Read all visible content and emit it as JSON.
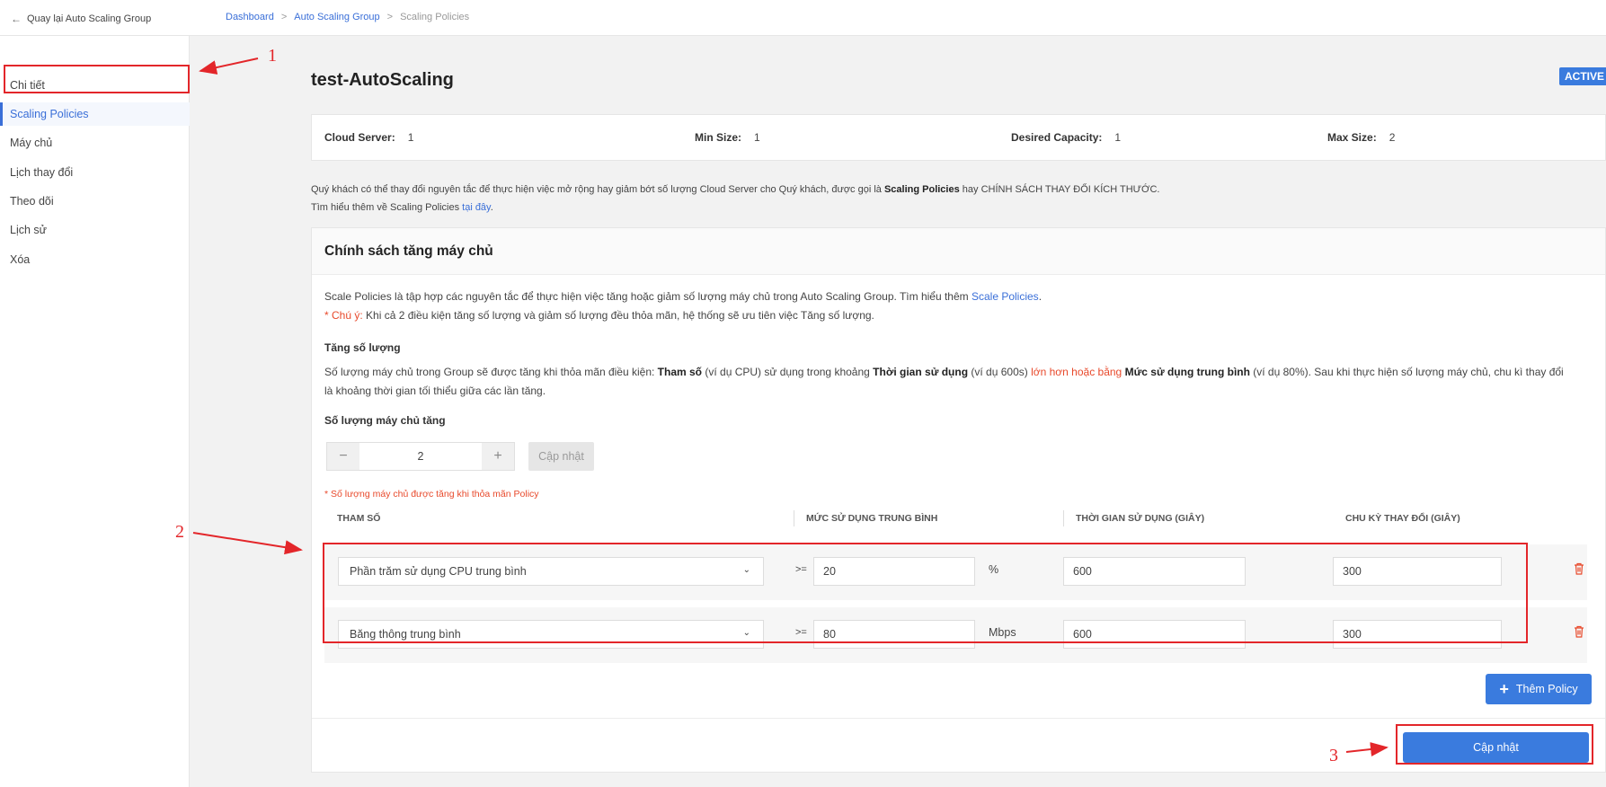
{
  "topbar": {
    "back_label": "Quay lại Auto Scaling Group",
    "breadcrumb": [
      "Dashboard",
      "Auto Scaling Group",
      "Scaling Policies"
    ]
  },
  "sidebar": {
    "items": [
      {
        "label": "Chi tiết"
      },
      {
        "label": "Scaling Policies"
      },
      {
        "label": "Máy chủ"
      },
      {
        "label": "Lịch thay đổi"
      },
      {
        "label": "Theo dõi"
      },
      {
        "label": "Lịch sử"
      },
      {
        "label": "Xóa"
      }
    ]
  },
  "header": {
    "title": "test-AutoScaling",
    "status": "ACTIVE"
  },
  "stats": [
    {
      "label": "Cloud Server:",
      "value": "1"
    },
    {
      "label": "Min Size:",
      "value": "1"
    },
    {
      "label": "Desired Capacity:",
      "value": "1"
    },
    {
      "label": "Max Size:",
      "value": "2"
    }
  ],
  "description": {
    "line1_a": "Quý khách có thể thay đổi nguyên tắc để thực hiện việc mở rộng hay giảm bớt số lượng Cloud Server cho Quý khách, được gọi là ",
    "line1_b": "Scaling Policies",
    "line1_c": " hay CHÍNH SÁCH THAY ĐỔI KÍCH THƯỚC.",
    "line2_a": "Tìm hiểu thêm về Scaling Policies ",
    "line2_link": "tại đây",
    "line2_c": "."
  },
  "panel": {
    "title": "Chính sách tăng máy chủ",
    "intro_a": "Scale Policies là tập hợp các nguyên tắc để thực hiện việc tăng hoặc giảm số lượng máy chủ trong Auto Scaling Group. Tìm hiểu thêm ",
    "intro_link": "Scale Policies",
    "intro_c": ".",
    "note_label": "* Chú ý:",
    "note_text": " Khi cả 2 điều kiện tăng số lượng và giảm số lượng đều thỏa mãn, hệ thống sẽ ưu tiên việc Tăng số lượng.",
    "increase_title": "Tăng số lượng",
    "increase_a": "Số lượng máy chủ trong Group sẽ được tăng khi thỏa mãn điều kiện: ",
    "increase_b": "Tham số",
    "increase_c": " (ví dụ CPU) sử dụng trong khoảng ",
    "increase_d": "Thời gian sử dụng",
    "increase_e": " (ví dụ 600s) ",
    "increase_f": "lớn hơn hoặc bằng",
    "increase_g": " ",
    "increase_h": "Mức sử dụng trung bình",
    "increase_i": " (ví dụ 80%). Sau khi thực hiện số lượng máy chủ, chu kì thay đổi",
    "increase_j": "là khoảng thời gian tối thiểu giữa các lần tăng.",
    "count_label": "Số lượng máy chủ tăng",
    "count_value": "2",
    "minus": "−",
    "plus": "+",
    "update_small": "Cập nhật",
    "count_note": "* Số lượng máy chủ được tăng khi thỏa mãn Policy",
    "columns": [
      "THAM SỐ",
      "MỨC SỬ DỤNG TRUNG BÌNH",
      "THỜI GIAN SỬ DỤNG (GIÂY)",
      "CHU KỲ THAY ĐỔI (GIÂY)"
    ],
    "rows": [
      {
        "param": "Phần trăm sử dụng CPU trung bình",
        "op": ">=",
        "avg": "20",
        "unit": "%",
        "time": "600",
        "cycle": "300"
      },
      {
        "param": "Băng thông trung bình",
        "op": ">=",
        "avg": "80",
        "unit": "Mbps",
        "time": "600",
        "cycle": "300"
      }
    ],
    "add_policy": "Thêm Policy",
    "save": "Cập nhật"
  },
  "annotations": {
    "n1": "1",
    "n2": "2",
    "n3": "3",
    "color": "#e3262a"
  },
  "colors": {
    "accent": "#3a7bde",
    "link": "#3a6fd8",
    "warning": "#e8492b"
  }
}
